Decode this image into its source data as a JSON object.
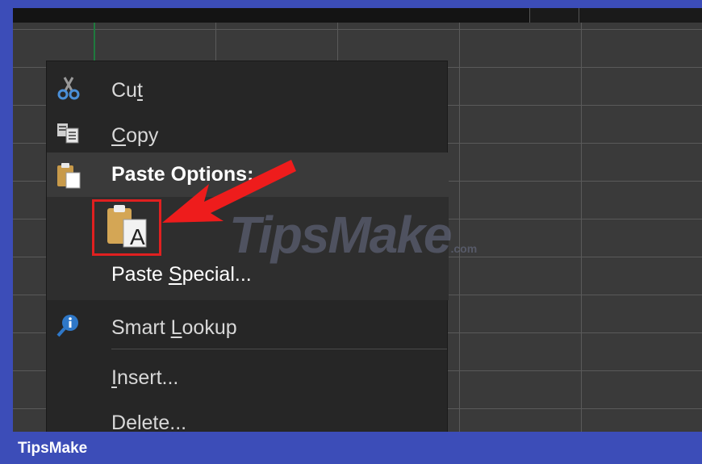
{
  "menu": {
    "cut_prefix": "Cu",
    "cut_underline": "t",
    "copy_underline": "C",
    "copy_rest": "opy",
    "paste_options": "Paste Options:",
    "paste_special_prefix": "Paste ",
    "paste_special_underline": "S",
    "paste_special_rest": "pecial...",
    "smart_lookup_prefix": "Smart ",
    "smart_lookup_underline": "L",
    "smart_lookup_rest": "ookup",
    "insert_underline": "I",
    "insert_rest": "nsert...",
    "delete_underline": "D",
    "delete_rest": "elete..."
  },
  "icons": {
    "cut": "scissors-icon",
    "copy": "copy-icon",
    "paste": "clipboard-icon",
    "paste_text_only": "clipboard-text-icon",
    "smart_lookup": "search-info-icon"
  },
  "paste_button_letter": "A",
  "watermark": {
    "text": "TipsMake",
    "suffix": ".com"
  },
  "footer": {
    "brand": "TipsMake"
  },
  "colors": {
    "frame": "#3c4db8",
    "menu_bg": "#262626",
    "highlight": "#e02020"
  }
}
